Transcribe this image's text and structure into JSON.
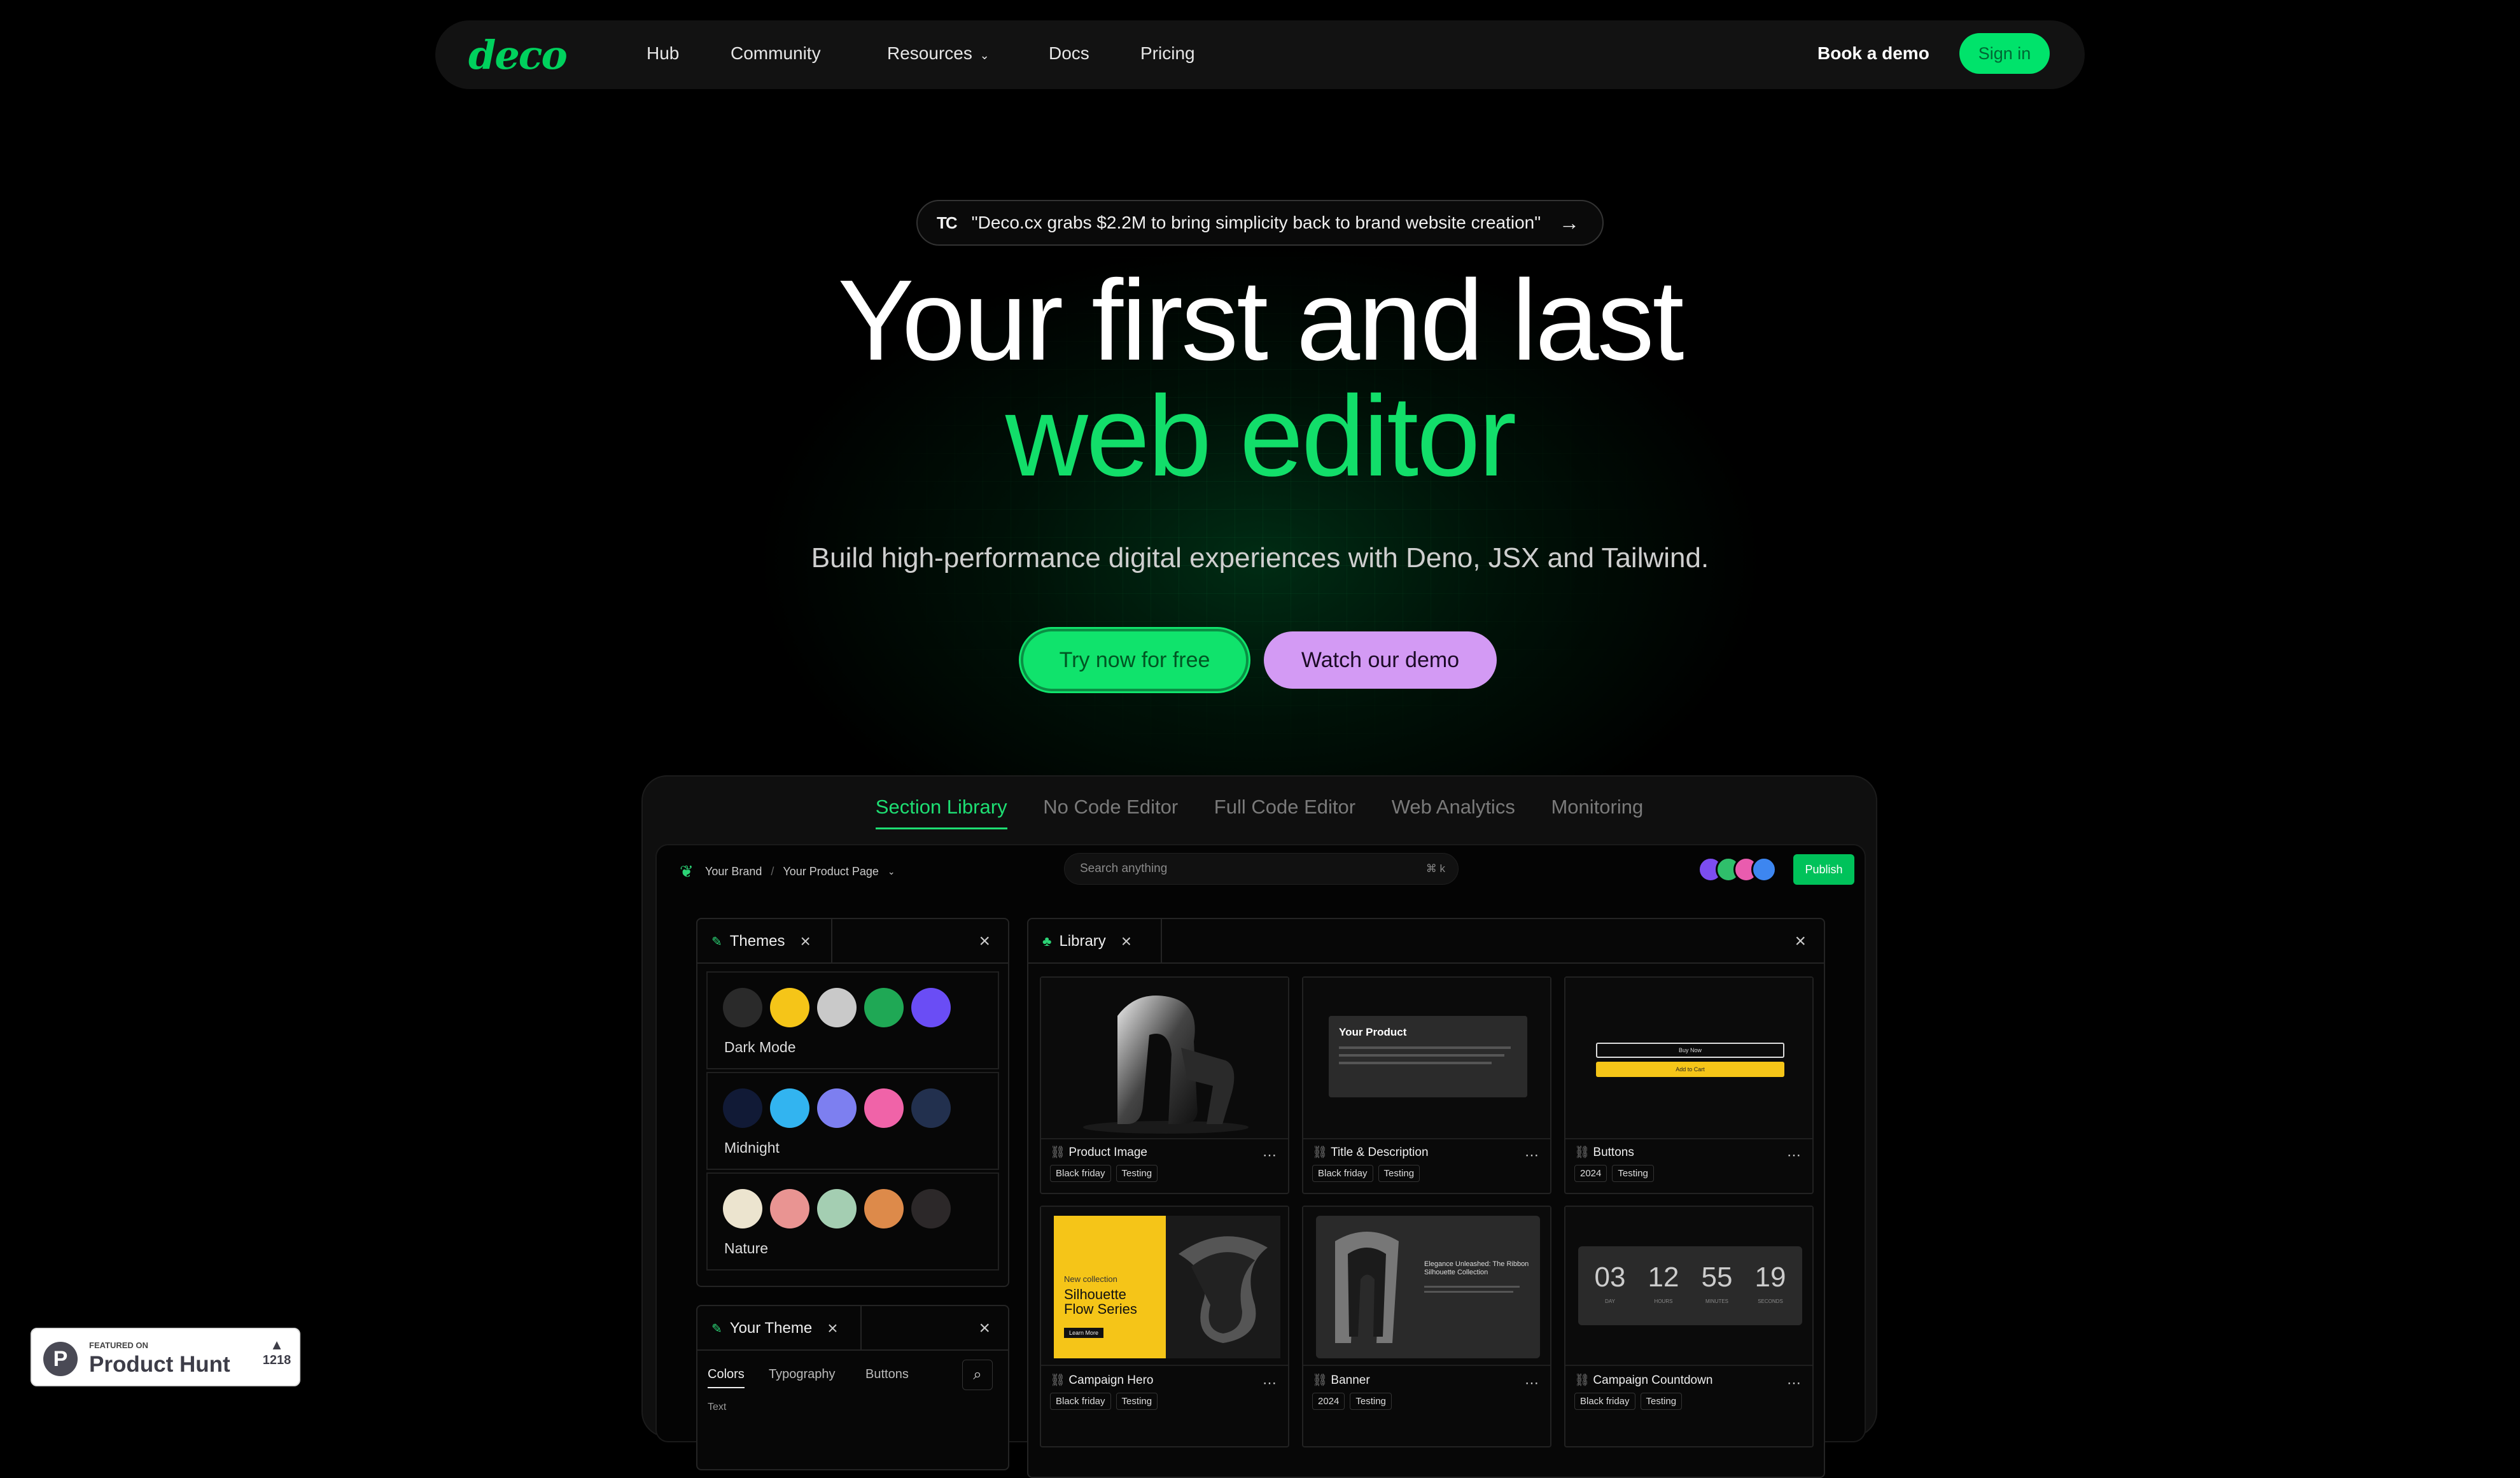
{
  "nav": {
    "logo": "deco",
    "links": [
      "Hub",
      "Community",
      "Resources",
      "Docs",
      "Pricing"
    ],
    "resources_chevron": "chevron-down-icon",
    "book_demo": "Book a demo",
    "sign_in": "Sign in"
  },
  "announcement": {
    "badge": "TC",
    "text": "\"Deco.cx grabs $2.2M to bring simplicity back to brand website creation\"",
    "arrow": "→"
  },
  "hero": {
    "title_line1": "Your first and last",
    "title_line2": "web editor",
    "subtitle": "Build high-performance digital experiences with Deno, JSX and Tailwind.",
    "cta_primary": "Try now for free",
    "cta_secondary": "Watch our demo"
  },
  "colors": {
    "accent": "#12de6a",
    "secondary": "#d39af4",
    "background": "#000000"
  },
  "showcase": {
    "tabs": [
      "Section Library",
      "No Code Editor",
      "Full Code Editor",
      "Web Analytics",
      "Monitoring"
    ],
    "active_tab": "Section Library",
    "editor": {
      "breadcrumb": [
        "Your Brand",
        "/",
        "Your Product Page"
      ],
      "search_placeholder": "Search anything",
      "search_shortcut": "⌘ k",
      "publish": "Publish",
      "themes_panel": {
        "title": "Themes",
        "themes": [
          {
            "name": "Dark Mode",
            "colors": [
              "#2a2a2a",
              "#f5c518",
              "#c9c9c9",
              "#1fa855",
              "#6a4df5"
            ]
          },
          {
            "name": "Midnight",
            "colors": [
              "#111a36",
              "#32b4f0",
              "#7d7ff0",
              "#f063a8",
              "#22304e"
            ]
          },
          {
            "name": "Nature",
            "colors": [
              "#ece4cf",
              "#e99492",
              "#a4ceb2",
              "#dd8a4a",
              "#2c2829"
            ]
          }
        ]
      },
      "your_theme_panel": {
        "title": "Your Theme",
        "tabs": [
          "Colors",
          "Typography",
          "Buttons"
        ],
        "section_label": "Text"
      },
      "library_panel": {
        "title": "Library",
        "cards": [
          {
            "name": "Product Image",
            "tags": [
              "Black friday",
              "Testing"
            ]
          },
          {
            "name": "Title & Description",
            "tags": [
              "Black friday",
              "Testing"
            ],
            "preview_title": "Your Product"
          },
          {
            "name": "Buttons",
            "tags": [
              "2024",
              "Testing"
            ],
            "preview_buttons": [
              "Buy Now",
              "Add to Cart"
            ]
          },
          {
            "name": "Campaign Hero",
            "tags": [
              "Black friday",
              "Testing"
            ],
            "preview_kicker": "New collection",
            "preview_title": "Silhouette Flow Series",
            "preview_cta": "Learn More"
          },
          {
            "name": "Banner",
            "tags": [
              "2024",
              "Testing"
            ],
            "preview_title": "Elegance Unleashed: The Ribbon Silhouette Collection"
          },
          {
            "name": "Campaign Countdown",
            "tags": [
              "Black friday",
              "Testing"
            ],
            "countdown": [
              {
                "value": "03",
                "unit": "DAY"
              },
              {
                "value": "12",
                "unit": "HOURS"
              },
              {
                "value": "55",
                "unit": "MINUTES"
              },
              {
                "value": "19",
                "unit": "SECONDS"
              }
            ]
          }
        ]
      }
    }
  },
  "product_hunt": {
    "featured": "FEATURED ON",
    "name": "Product Hunt",
    "upvotes": "1218"
  }
}
